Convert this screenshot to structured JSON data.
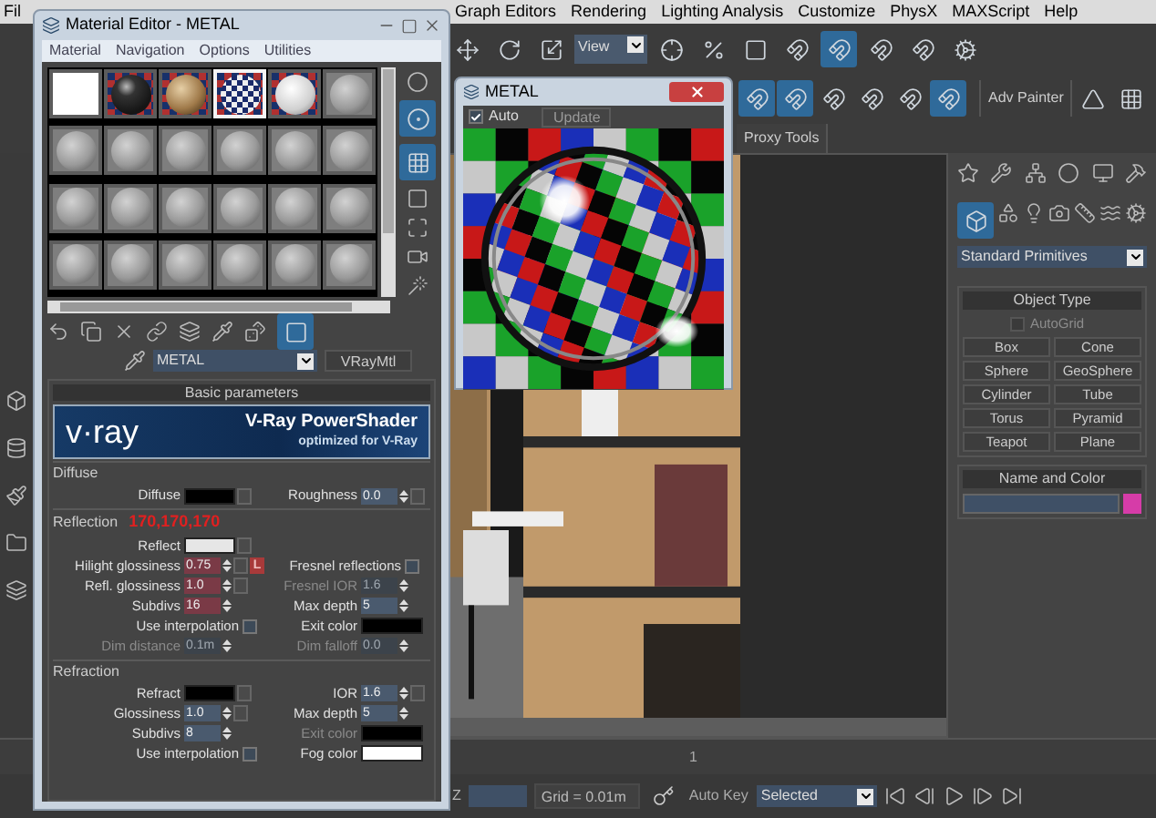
{
  "menu_bar": [
    {
      "label": "Fil"
    },
    {
      "label": "Graph Editors"
    },
    {
      "label": "Rendering"
    },
    {
      "label": "Lighting Analysis"
    },
    {
      "label": "Customize"
    },
    {
      "label": "PhysX"
    },
    {
      "label": "MAXScript"
    },
    {
      "label": "Help"
    }
  ],
  "main_toolbar": {
    "view_dropdown": "View"
  },
  "ribbon": {
    "button": "Adv Painter",
    "tab": "Proxy Tools"
  },
  "command_panel": {
    "dropdown": "Standard Primitives",
    "object_type": {
      "title": "Object Type",
      "autogrid": {
        "label": "AutoGrid",
        "checked": false,
        "disabled": true
      },
      "buttons": [
        "Box",
        "Cone",
        "Sphere",
        "GeoSphere",
        "Cylinder",
        "Tube",
        "Torus",
        "Pyramid",
        "Teapot",
        "Plane"
      ]
    },
    "name_and_color": {
      "title": "Name and Color",
      "color": "#d63ca8"
    }
  },
  "timeline": {
    "frame": "1"
  },
  "status_bar": {
    "axis_label": "Z",
    "grid": "Grid = 0.01m",
    "auto_key": "Auto Key",
    "key_filter": "Selected"
  },
  "material_editor": {
    "title": "Material Editor - METAL",
    "menu": [
      "Material",
      "Navigation",
      "Options",
      "Utilities"
    ],
    "slots": [
      {
        "kind": "blank",
        "selected": false
      },
      {
        "kind": "dark",
        "selected": false
      },
      {
        "kind": "tan",
        "selected": false
      },
      {
        "kind": "checker",
        "selected": true
      },
      {
        "kind": "white",
        "selected": false
      },
      {
        "kind": "grey",
        "selected": false
      },
      {
        "kind": "grey",
        "selected": false
      },
      {
        "kind": "grey",
        "selected": false
      },
      {
        "kind": "grey",
        "selected": false
      },
      {
        "kind": "grey",
        "selected": false
      },
      {
        "kind": "grey",
        "selected": false
      },
      {
        "kind": "grey",
        "selected": false
      },
      {
        "kind": "grey",
        "selected": false
      },
      {
        "kind": "grey",
        "selected": false
      },
      {
        "kind": "grey",
        "selected": false
      },
      {
        "kind": "grey",
        "selected": false
      },
      {
        "kind": "grey",
        "selected": false
      },
      {
        "kind": "grey",
        "selected": false
      },
      {
        "kind": "grey",
        "selected": false
      },
      {
        "kind": "grey",
        "selected": false
      },
      {
        "kind": "grey",
        "selected": false
      },
      {
        "kind": "grey",
        "selected": false
      },
      {
        "kind": "grey",
        "selected": false
      },
      {
        "kind": "grey",
        "selected": false
      }
    ],
    "material_name": "METAL",
    "material_type": "VRayMtl",
    "rollout": "Basic parameters",
    "banner": {
      "logo": "v·ray",
      "title": "V-Ray PowerShader",
      "subtitle": "optimized for V-Ray"
    },
    "sections": [
      {
        "title": "Diffuse",
        "rows": [
          {
            "left": {
              "kind": "swatch",
              "label": "Diffuse",
              "color": "#000000",
              "map_button": true
            },
            "right": {
              "kind": "spinner",
              "label": "Roughness",
              "value": "0.0",
              "map_button": true
            }
          }
        ]
      },
      {
        "title": "Reflection",
        "note": "170,170,170",
        "rows": [
          {
            "left": {
              "kind": "swatch",
              "label": "Reflect",
              "color": "#e6e6e6",
              "map_button": true
            }
          },
          {
            "left": {
              "kind": "spinner",
              "label": "Hilight glossiness",
              "value": "0.75",
              "highlighted": true,
              "map_button": true,
              "lock": "L"
            },
            "right": {
              "kind": "checkbox",
              "label": "Fresnel reflections",
              "checked": false
            }
          },
          {
            "left": {
              "kind": "spinner",
              "label": "Refl. glossiness",
              "value": "1.0",
              "highlighted": true,
              "map_button": true
            },
            "right": {
              "kind": "spinner",
              "label": "Fresnel IOR",
              "value": "1.6",
              "disabled": true
            }
          },
          {
            "left": {
              "kind": "spinner",
              "label": "Subdivs",
              "value": "16",
              "highlighted": true
            },
            "right": {
              "kind": "spinner",
              "label": "Max depth",
              "value": "5"
            }
          },
          {
            "left": {
              "kind": "checkbox",
              "label": "Use interpolation",
              "checked": false
            },
            "right": {
              "kind": "swatch",
              "label": "Exit color",
              "color": "#000000"
            }
          },
          {
            "left": {
              "kind": "spinner",
              "label": "Dim distance",
              "value": "0.1m",
              "disabled": true
            },
            "right": {
              "kind": "spinner",
              "label": "Dim falloff",
              "value": "0.0",
              "disabled": true
            }
          }
        ]
      },
      {
        "title": "Refraction",
        "rows": [
          {
            "left": {
              "kind": "swatch",
              "label": "Refract",
              "color": "#000000",
              "map_button": true
            },
            "right": {
              "kind": "spinner",
              "label": "IOR",
              "value": "1.6",
              "map_button": true
            }
          },
          {
            "left": {
              "kind": "spinner",
              "label": "Glossiness",
              "value": "1.0",
              "map_button": true
            },
            "right": {
              "kind": "spinner",
              "label": "Max depth",
              "value": "5"
            }
          },
          {
            "left": {
              "kind": "spinner",
              "label": "Subdivs",
              "value": "8"
            },
            "right": {
              "kind": "swatch",
              "label": "Exit color",
              "color": "#000000",
              "disabled": true
            }
          },
          {
            "left": {
              "kind": "checkbox",
              "label": "Use interpolation",
              "checked": false
            },
            "right": {
              "kind": "swatch",
              "label": "Fog color",
              "color": "#ffffff"
            }
          }
        ]
      }
    ]
  },
  "preview_window": {
    "title": "METAL",
    "auto": {
      "label": "Auto",
      "checked": true
    },
    "update": {
      "label": "Update",
      "disabled": true
    }
  }
}
